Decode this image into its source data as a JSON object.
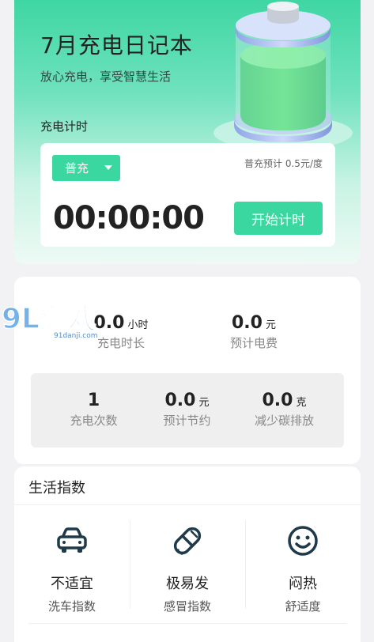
{
  "hero": {
    "title": "7月充电日记本",
    "subtitle": "放心充电，享受智慧生活",
    "timer_label": "充电计时"
  },
  "timer_card": {
    "mode": "普充",
    "price_note": "普充预计 0.5元/度",
    "timer_value": "00:00:00",
    "start_label": "开始计时"
  },
  "stats": {
    "duration": {
      "value": "0.0",
      "unit": "小时",
      "label": "充电时长"
    },
    "fee": {
      "value": "0.0",
      "unit": "元",
      "label": "预计电费"
    },
    "count": {
      "value": "1",
      "label": "充电次数"
    },
    "saving": {
      "value": "0.0",
      "unit": "元",
      "label": "预计节约"
    },
    "carbon": {
      "value": "0.0",
      "unit": "克",
      "label": "减少碳排放"
    }
  },
  "watermark": {
    "text": "9L游戏",
    "url_text": "91danji.com"
  },
  "life": {
    "title": "生活指数",
    "items": [
      {
        "icon": "car-icon",
        "value": "不适宜",
        "label": "洗车指数"
      },
      {
        "icon": "pill-icon",
        "value": "极易发",
        "label": "感冒指数"
      },
      {
        "icon": "smile-icon",
        "value": "闷热",
        "label": "舒适度"
      }
    ]
  },
  "colors": {
    "accent": "#3ad8a0",
    "icon": "#1f3a4a"
  }
}
